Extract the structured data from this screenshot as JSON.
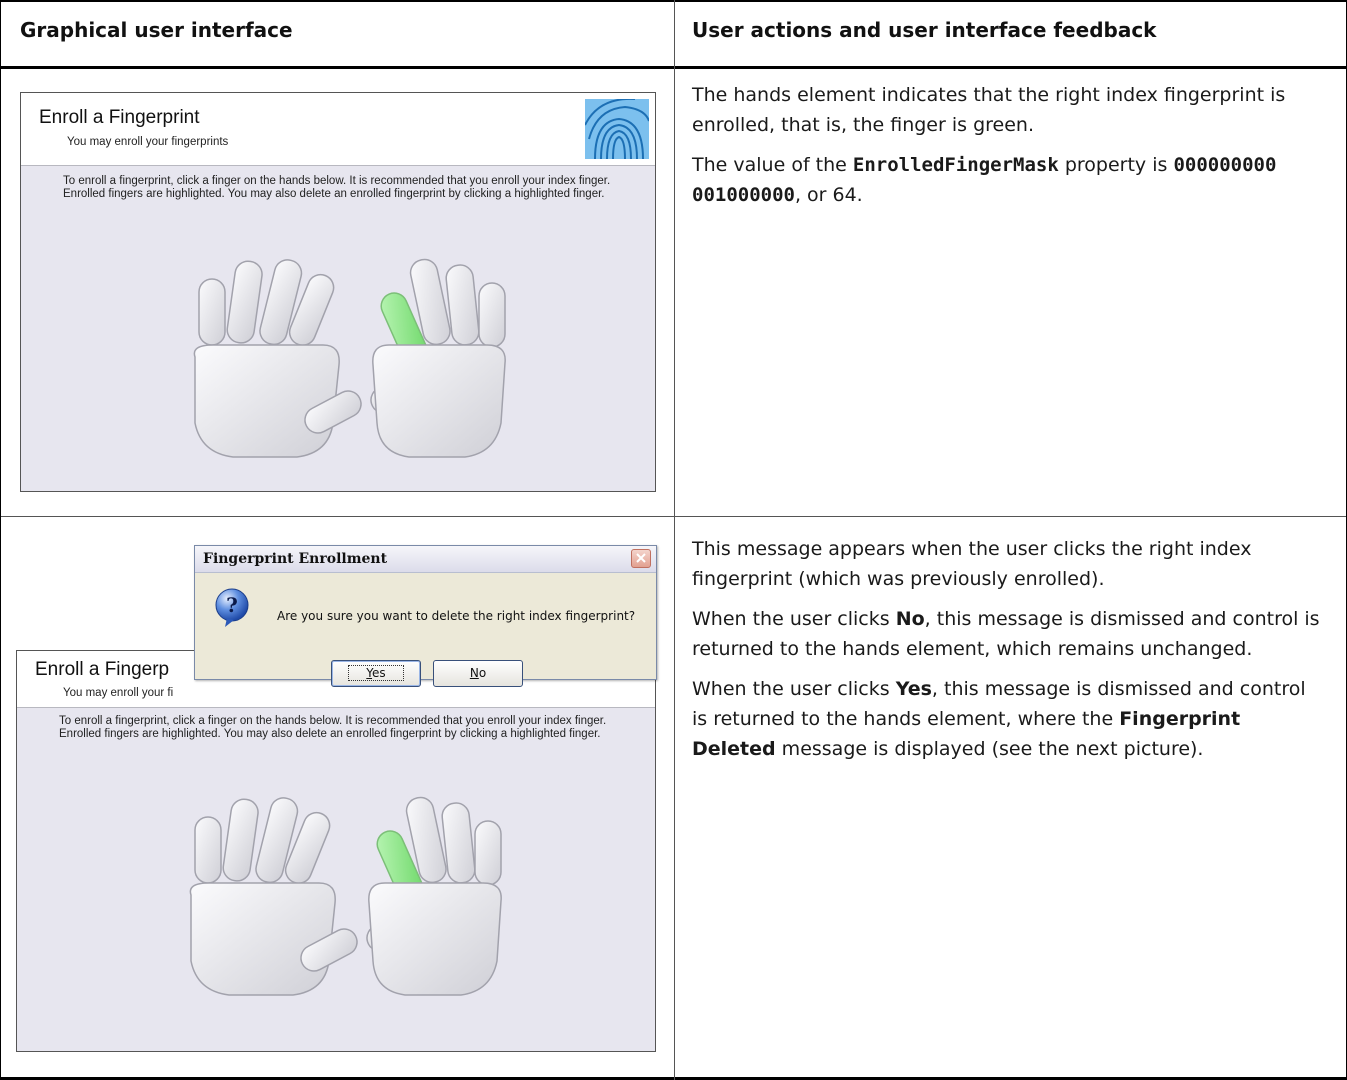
{
  "table": {
    "col1_header": "Graphical user interface",
    "col2_header": "User actions and user interface feedback"
  },
  "row1": {
    "screenshot": {
      "title": "Enroll a Fingerprint",
      "subtitle": "You may enroll your fingerprints",
      "instructions": "To enroll a fingerprint, click a finger on the hands below. It is recommended that you enroll your index finger. Enrolled fingers are highlighted. You may also delete an enrolled fingerprint by clicking a highlighted finger.",
      "enrolled_finger": "right-index",
      "enrolled_color": "#8fe58c"
    },
    "feedback": {
      "p1": "The hands element indicates that the right index fingerprint is enrolled, that is, the finger is green.",
      "p2_prefix": "The value of the ",
      "p2_code": "EnrolledFingerMask",
      "p2_mid": " property is ",
      "p2_value": "000000000 001000000",
      "p2_suffix": ", or 64."
    }
  },
  "row2": {
    "screenshot": {
      "title": "Enroll a Fingerp",
      "subtitle": "You may enroll your fi",
      "instructions": "To enroll a fingerprint, click a finger on the hands below. It is recommended that you enroll your index finger. Enrolled fingers are highlighted. You may also delete an enrolled fingerprint by clicking a highlighted finger.",
      "enrolled_finger": "right-index"
    },
    "dialog": {
      "title": "Fingerprint Enrollment",
      "message": "Are you sure you want to delete the right index fingerprint?",
      "yes_first": "Y",
      "yes_rest": "es",
      "no_first": "N",
      "no_rest": "o"
    },
    "feedback": {
      "p1": "This message appears when the user clicks the right index fingerprint (which was previously enrolled).",
      "p2_prefix": "When the user clicks ",
      "p2_bold": "No",
      "p2_suffix": ", this message is dismissed and control is returned to the hands element, which remains unchanged.",
      "p3_prefix": "When the user clicks ",
      "p3_bold": "Yes",
      "p3_mid": ", this message is dismissed and control is returned to the hands element, where the ",
      "p3_bold2": "Fingerprint Deleted",
      "p3_suffix": " message is displayed (see the next picture)."
    }
  }
}
